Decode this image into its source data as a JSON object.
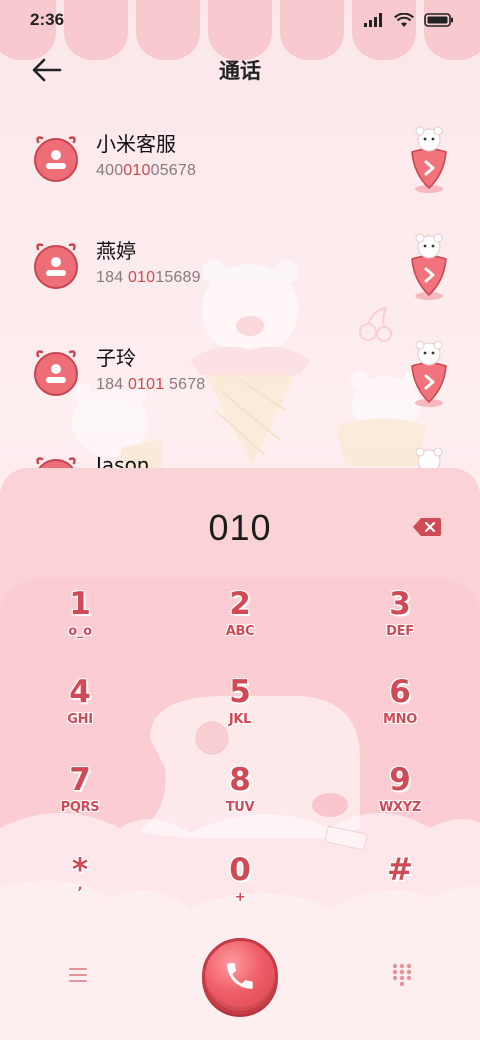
{
  "status_bar": {
    "time": "2:36"
  },
  "header": {
    "title": "通话"
  },
  "contacts": [
    {
      "name": "小米客服",
      "number_parts": [
        "400",
        "010",
        "05678"
      ]
    },
    {
      "name": "燕婷",
      "number_parts": [
        "184 ",
        "010",
        "15689"
      ]
    },
    {
      "name": "子玲",
      "number_parts": [
        "184 ",
        "0101",
        " 5678"
      ]
    },
    {
      "name": "Jason"
    }
  ],
  "dialer": {
    "input_value": "010",
    "keys": [
      {
        "digit": "1",
        "letters": "o_o"
      },
      {
        "digit": "2",
        "letters": "ABC"
      },
      {
        "digit": "3",
        "letters": "DEF"
      },
      {
        "digit": "4",
        "letters": "GHI"
      },
      {
        "digit": "5",
        "letters": "JKL"
      },
      {
        "digit": "6",
        "letters": "MNO"
      },
      {
        "digit": "7",
        "letters": "PQRS"
      },
      {
        "digit": "8",
        "letters": "TUV"
      },
      {
        "digit": "9",
        "letters": "WXYZ"
      },
      {
        "digit": "*",
        "letters": ","
      },
      {
        "digit": "0",
        "letters": "+"
      },
      {
        "digit": "#",
        "letters": ""
      }
    ]
  },
  "icons": {
    "back": "back-arrow-icon",
    "avatar": "contact-avatar-icon",
    "detail": "contact-detail-icon",
    "delete": "backspace-icon",
    "menu": "menu-icon",
    "call": "phone-icon",
    "keypad": "keypad-icon"
  },
  "colors": {
    "accent": "#cf4a55",
    "highlight": "#d04850",
    "panel": "#fbd2d6",
    "background": "#fbe7e9"
  }
}
